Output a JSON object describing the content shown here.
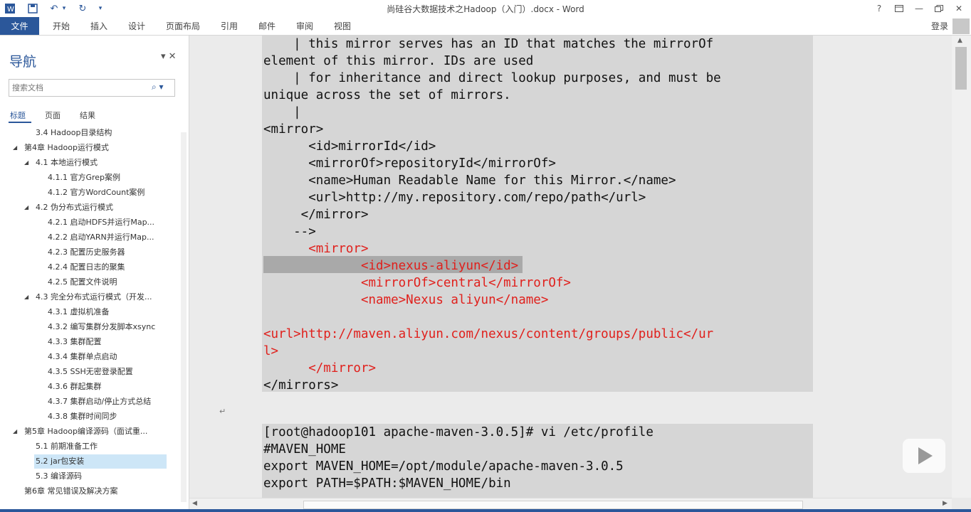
{
  "app": {
    "doc_title": "尚硅谷大数据技术之Hadoop（入门）.docx - Word",
    "help_icon": "?",
    "signin": "登录"
  },
  "ribbon": {
    "file_tab": "文件",
    "tabs": [
      "开始",
      "插入",
      "设计",
      "页面布局",
      "引用",
      "邮件",
      "审阅",
      "视图"
    ]
  },
  "nav": {
    "title": "导航",
    "search_placeholder": "搜索文档",
    "tabs": [
      "标题",
      "页面",
      "结果"
    ],
    "items": [
      {
        "label": "3.4 Hadoop目录结构",
        "level": 2,
        "arrow": "",
        "selected": false
      },
      {
        "label": "第4章 Hadoop运行模式",
        "level": 1,
        "arrow": "◢",
        "selected": false
      },
      {
        "label": "4.1 本地运行模式",
        "level": 2,
        "arrow": "◢",
        "selected": false
      },
      {
        "label": "4.1.1 官方Grep案例",
        "level": 3,
        "arrow": "",
        "selected": false
      },
      {
        "label": "4.1.2 官方WordCount案例",
        "level": 3,
        "arrow": "",
        "selected": false
      },
      {
        "label": "4.2 伪分布式运行模式",
        "level": 2,
        "arrow": "◢",
        "selected": false
      },
      {
        "label": "4.2.1 启动HDFS并运行Map...",
        "level": 3,
        "arrow": "",
        "selected": false
      },
      {
        "label": "4.2.2 启动YARN并运行Map...",
        "level": 3,
        "arrow": "",
        "selected": false
      },
      {
        "label": "4.2.3 配置历史服务器",
        "level": 3,
        "arrow": "",
        "selected": false
      },
      {
        "label": "4.2.4 配置日志的聚集",
        "level": 3,
        "arrow": "",
        "selected": false
      },
      {
        "label": "4.2.5 配置文件说明",
        "level": 3,
        "arrow": "",
        "selected": false
      },
      {
        "label": "4.3 完全分布式运行模式（开发...",
        "level": 2,
        "arrow": "◢",
        "selected": false
      },
      {
        "label": "4.3.1 虚拟机准备",
        "level": 3,
        "arrow": "",
        "selected": false
      },
      {
        "label": "4.3.2 编写集群分发脚本xsync",
        "level": 3,
        "arrow": "",
        "selected": false
      },
      {
        "label": "4.3.3 集群配置",
        "level": 3,
        "arrow": "",
        "selected": false
      },
      {
        "label": "4.3.4 集群单点启动",
        "level": 3,
        "arrow": "",
        "selected": false
      },
      {
        "label": "4.3.5 SSH无密登录配置",
        "level": 3,
        "arrow": "",
        "selected": false
      },
      {
        "label": "4.3.6 群起集群",
        "level": 3,
        "arrow": "",
        "selected": false
      },
      {
        "label": "4.3.7 集群启动/停止方式总结",
        "level": 3,
        "arrow": "",
        "selected": false
      },
      {
        "label": "4.3.8 集群时间同步",
        "level": 3,
        "arrow": "",
        "selected": false
      },
      {
        "label": "第5章 Hadoop编译源码（面试重...",
        "level": 1,
        "arrow": "◢",
        "selected": false
      },
      {
        "label": "5.1 前期准备工作",
        "level": 2,
        "arrow": "",
        "selected": false
      },
      {
        "label": "5.2 jar包安装",
        "level": 2,
        "arrow": "",
        "selected": true
      },
      {
        "label": "5.3 编译源码",
        "level": 2,
        "arrow": "",
        "selected": false
      },
      {
        "label": "第6章 常见错误及解决方案",
        "level": 1,
        "arrow": "",
        "selected": false
      }
    ]
  },
  "doc": {
    "lines1": [
      {
        "t": "    | this mirror serves has an ID that matches the mirrorOf",
        "c": "normal"
      },
      {
        "t": "element of this mirror. IDs are used",
        "c": "normal"
      },
      {
        "t": "    | for inheritance and direct lookup purposes, and must be",
        "c": "normal"
      },
      {
        "t": "unique across the set of mirrors.",
        "c": "normal"
      },
      {
        "t": "    |",
        "c": "normal"
      },
      {
        "t": "<mirror>",
        "c": "normal"
      },
      {
        "t": "      <id>mirrorId</id>",
        "c": "normal"
      },
      {
        "t": "      <mirrorOf>repositoryId</mirrorOf>",
        "c": "normal"
      },
      {
        "t": "      <name>Human Readable Name for this Mirror.</name>",
        "c": "normal"
      },
      {
        "t": "      <url>http://my.repository.com/repo/path</url>",
        "c": "normal"
      },
      {
        "t": "     </mirror>",
        "c": "normal"
      },
      {
        "t": "    -->",
        "c": "normal"
      },
      {
        "t": "      <mirror>",
        "c": "red"
      },
      {
        "t": "             <id>nexus-aliyun</id>",
        "c": "red"
      },
      {
        "t": "             <mirrorOf>central</mirrorOf>",
        "c": "red"
      },
      {
        "t": "             <name>Nexus aliyun</name>",
        "c": "red"
      },
      {
        "t": "",
        "c": "normal"
      },
      {
        "t": "<url>http://maven.aliyun.com/nexus/content/groups/public</ur",
        "c": "red"
      },
      {
        "t": "l>",
        "c": "red"
      },
      {
        "t": "      </mirror>",
        "c": "red"
      },
      {
        "t": "</mirrors>",
        "c": "normal"
      }
    ],
    "lines2": [
      "[root@hadoop101 apache-maven-3.0.5]# vi /etc/profile",
      "#MAVEN_HOME",
      "export MAVEN_HOME=/opt/module/apache-maven-3.0.5",
      "export PATH=$PATH:$MAVEN_HOME/bin"
    ],
    "paragraph_mark": "↵"
  }
}
